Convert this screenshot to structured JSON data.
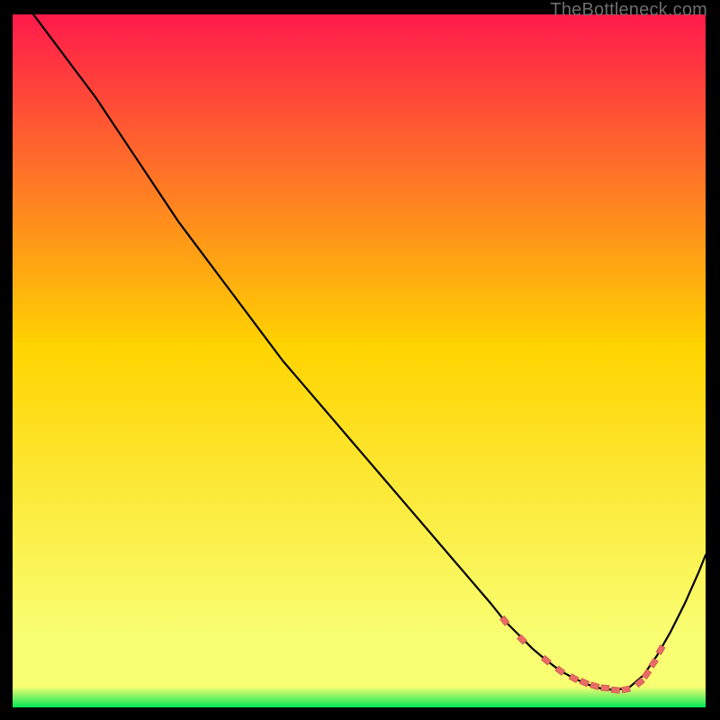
{
  "watermark": "TheBottleneck.com",
  "colors": {
    "bg_top": "#ff1a4b",
    "bg_mid": "#ffd400",
    "bg_low": "#f9ff73",
    "bg_bottom": "#00e756",
    "curve": "#000000",
    "marker_fill": "#e86b66",
    "marker_stroke": "#c94e4a"
  },
  "chart_data": {
    "type": "line",
    "title": "",
    "xlabel": "",
    "ylabel": "",
    "xlim": [
      0,
      100
    ],
    "ylim": [
      0,
      100
    ],
    "grid": false,
    "legend": false,
    "series": [
      {
        "name": "bottleneck-curve",
        "x": [
          3,
          6,
          9,
          12,
          15,
          18,
          21,
          24,
          27,
          30,
          33,
          36,
          39,
          42,
          45,
          48,
          51,
          54,
          57,
          60,
          63,
          66,
          69,
          71,
          73,
          75,
          77,
          79,
          81,
          83,
          85,
          87,
          89,
          91,
          93,
          95,
          97,
          99,
          100
        ],
        "y": [
          100,
          96,
          92,
          88,
          83.5,
          79,
          74.5,
          70,
          66,
          62,
          58,
          54,
          50,
          46.5,
          43,
          39.5,
          36,
          32.5,
          29,
          25.5,
          22,
          18.5,
          15,
          12.5,
          10.5,
          8.5,
          6.8,
          5.3,
          4.2,
          3.3,
          2.7,
          2.5,
          2.9,
          4.6,
          7.5,
          11,
          15,
          19.5,
          22
        ]
      }
    ],
    "markers": {
      "name": "highlight-points",
      "x": [
        71,
        73.5,
        77,
        79,
        81,
        82.5,
        84,
        85.5,
        87,
        88.5,
        90.5,
        91.5,
        92.5,
        93.5
      ],
      "y": [
        12.5,
        9.8,
        6.8,
        5.3,
        4.2,
        3.6,
        3.1,
        2.8,
        2.5,
        2.6,
        3.6,
        4.8,
        6.4,
        8.3
      ]
    }
  }
}
